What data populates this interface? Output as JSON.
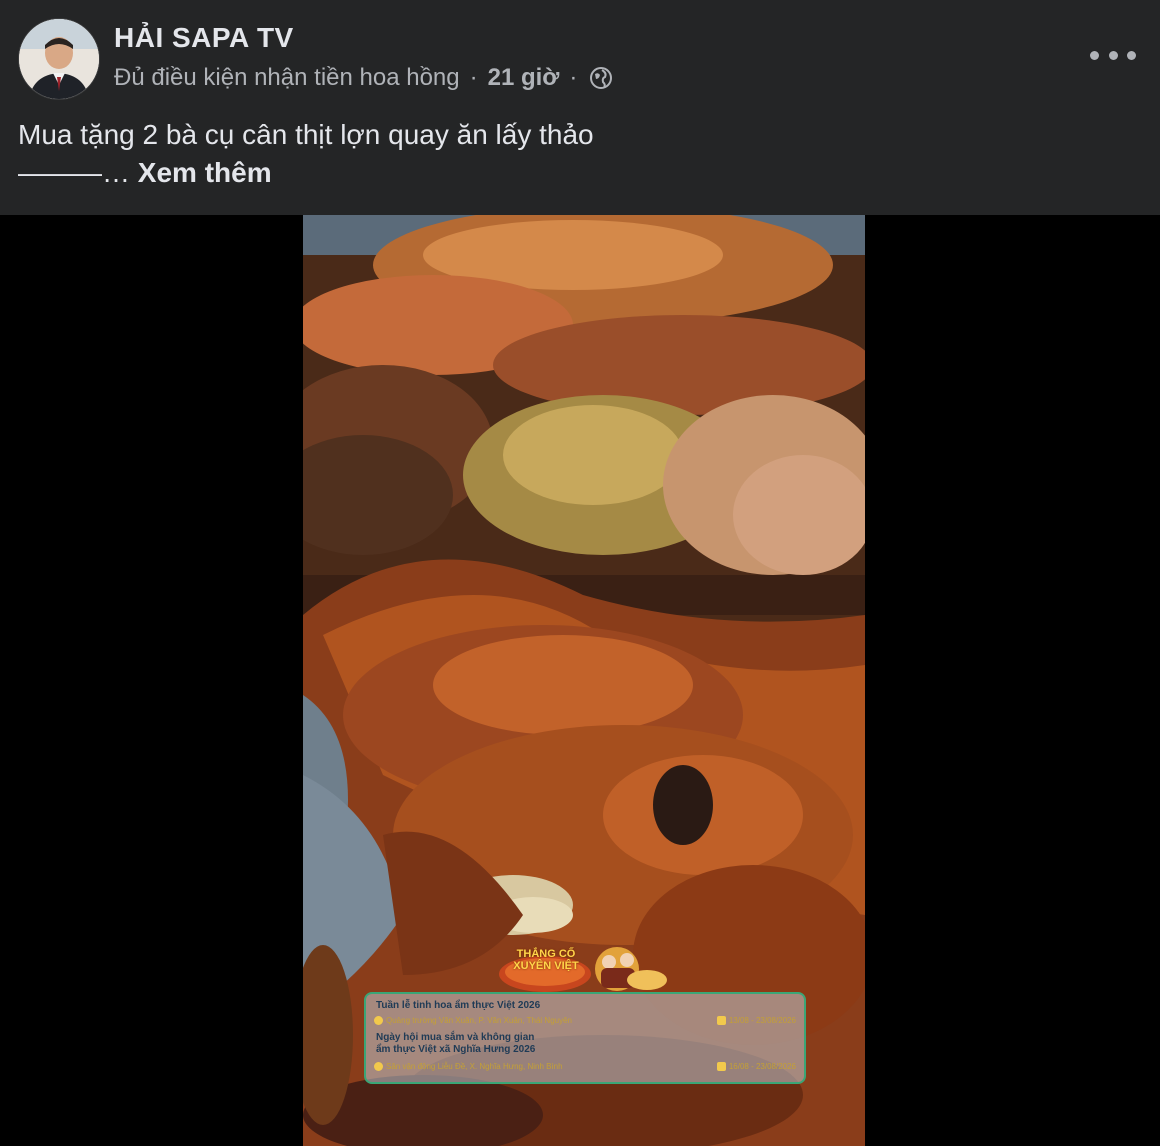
{
  "post": {
    "author": "HẢI SAPA TV",
    "meta_text": "Đủ điều kiện nhận tiền hoa hồng",
    "meta_separator": "·",
    "time": "21 giờ",
    "privacy_icon": "globe-icon",
    "more_icon": "more-options-icon",
    "caption_line1": "Mua tặng 2 bà cụ cân thịt lợn quay ăn lấy thảo",
    "caption_line2": "———… ",
    "see_more": "Xem thêm"
  },
  "video_overlay": {
    "logo_line1": "THẮNG CỐ",
    "logo_line2": "XUYÊN VIỆT",
    "event1_title": "Tuần lễ tinh hoa ẩm thực Việt 2026",
    "event1_location": "Quảng trường Văn Xuân, P. Văn Xuân, Thái Nguyên",
    "event1_dates": "13/08 - 23/08/2026",
    "event2_title_line1": "Ngày hội mua sắm và không gian",
    "event2_title_line2": "ẩm thực Việt xã Nghĩa Hưng 2026",
    "event2_location": "Sân vận động Liễu Đề, X. Nghĩa Hưng, Ninh Bình",
    "event2_dates": "16/08 - 23/08/2026"
  },
  "colors": {
    "header_bg": "#242526",
    "primary_text": "#e4e6eb",
    "secondary_text": "#b0b3b8",
    "banner_border": "#3aa676"
  }
}
